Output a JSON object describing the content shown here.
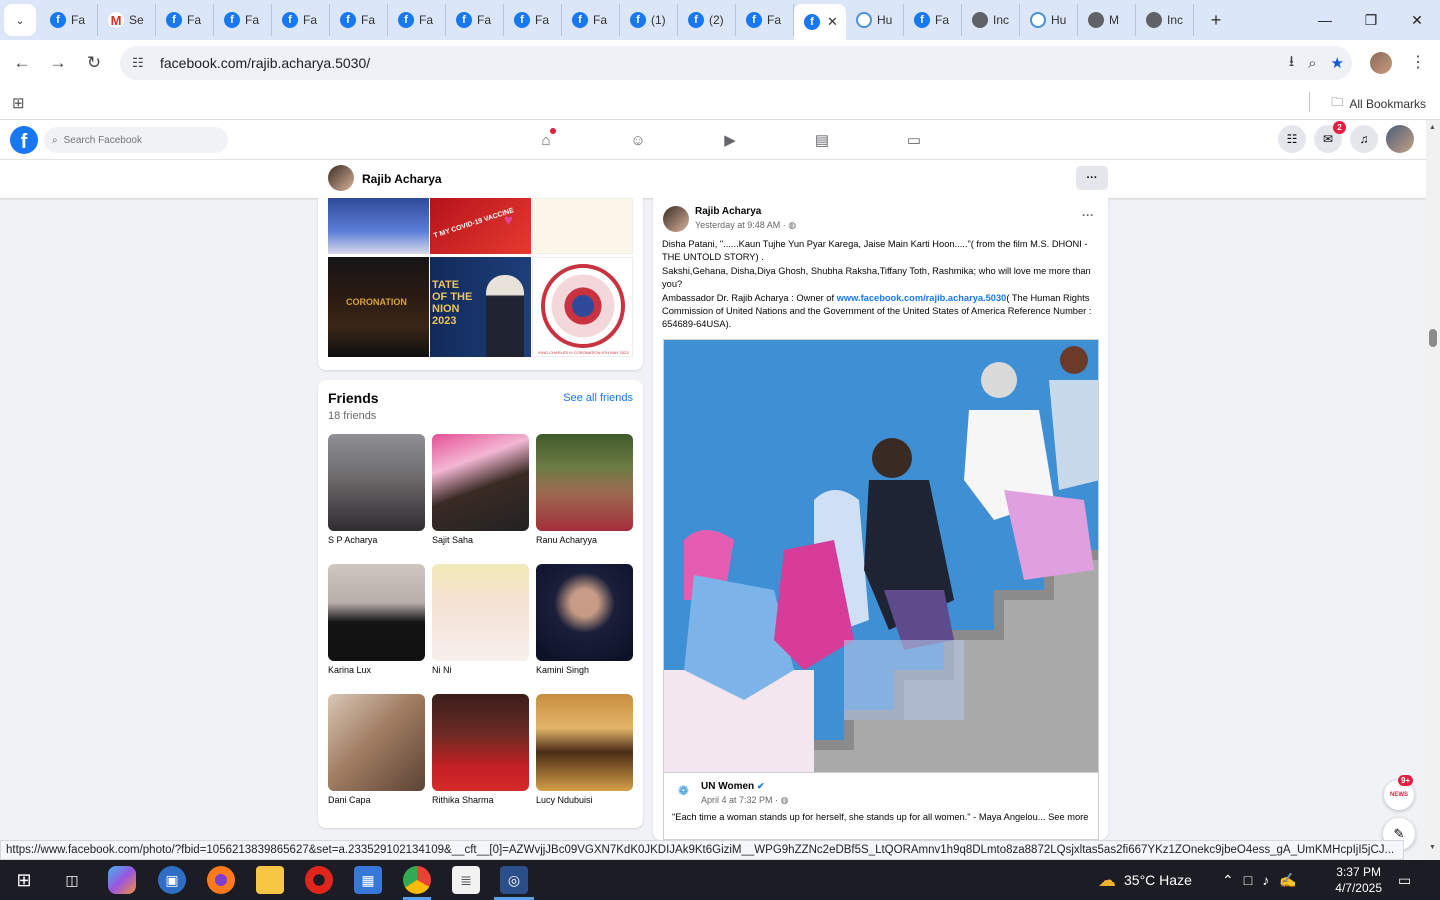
{
  "browser": {
    "tabs": [
      {
        "label": "Fa",
        "icon": "facebook"
      },
      {
        "label": "Se",
        "icon": "gmail"
      },
      {
        "label": "Fa",
        "icon": "facebook"
      },
      {
        "label": "Fa",
        "icon": "facebook"
      },
      {
        "label": "Fa",
        "icon": "facebook"
      },
      {
        "label": "Fa",
        "icon": "facebook"
      },
      {
        "label": "Fa",
        "icon": "facebook"
      },
      {
        "label": "Fa",
        "icon": "facebook"
      },
      {
        "label": "Fa",
        "icon": "facebook"
      },
      {
        "label": "Fa",
        "icon": "facebook"
      },
      {
        "label": "(1)",
        "icon": "facebook"
      },
      {
        "label": "(2)",
        "icon": "facebook"
      },
      {
        "label": "Fa",
        "icon": "facebook"
      },
      {
        "label": "",
        "icon": "facebook",
        "active": true
      },
      {
        "label": "Hu",
        "icon": "hive"
      },
      {
        "label": "Fa",
        "icon": "facebook"
      },
      {
        "label": "Inc",
        "icon": "globe"
      },
      {
        "label": "Hu",
        "icon": "hive"
      },
      {
        "label": "M",
        "icon": "globe"
      },
      {
        "label": "Inc",
        "icon": "globe"
      }
    ],
    "url": "facebook.com/rajib.acharya.5030/",
    "bookmarks_label": "All Bookmarks",
    "status_url": "https://www.facebook.com/photo/?fbid=1056213839865627&set=a.233529102134109&__cft__[0]=AZWvjjJBc09VGXN7KdK0JKDIJAk9Kt6GiziM__WPG9hZZNc2eDBf5S_LtQORAmnv1h9q8DLmto8za8872LQsjxltas5as2fi667YKz1ZOnekc9jbeO4ess_gA_UmKMHcpIjI5jCJ..."
  },
  "facebook": {
    "search_placeholder": "Search Facebook",
    "messenger_badge": "2",
    "profile_name": "Rajib Acharya",
    "more_label": "···"
  },
  "friends": {
    "title": "Friends",
    "count": "18 friends",
    "see_all": "See all friends",
    "items": [
      {
        "name": "S P Acharya"
      },
      {
        "name": "Sajit Saha"
      },
      {
        "name": "Ranu Acharyya"
      },
      {
        "name": "Karina Lux"
      },
      {
        "name": "Ni Ni"
      },
      {
        "name": "Kamini Singh"
      },
      {
        "name": "Dani Capa"
      },
      {
        "name": "Rithika Sharma"
      },
      {
        "name": "Lucy Ndubuisi"
      }
    ]
  },
  "photos": {
    "p1_caption": "T MY COVID-19 VACCINE",
    "p2_caption": "CORONATION",
    "p3_caption": "TATE OF THE NION 2023",
    "p4_caption": "KING CHARLES III CORONATION 6TH MAY 2023"
  },
  "post": {
    "author": "Rajib Acharya",
    "time": "Yesterday at 9:48 AM ·",
    "text_1": "Disha Patani, \"......Kaun Tujhe Yun Pyar Karega, Jaise Main Karti Hoon.....\"( from the film M.S. DHONI -THE UNTOLD STORY) .",
    "text_2": "Sakshi,Gehana, Disha,Diya Ghosh, Shubha Raksha,Tiffany Toth, Rashmika; who will love me more than you?",
    "text_3a": "Ambassador Dr. Rajib Acharya : Owner of ",
    "text_3_link": "www.facebook.com/rajib.acharya.5030",
    "text_3b": "( The Human Rights Commission of United Nations and the Government of the United  States of America Reference Number : 654689-64USA).",
    "shared_author": "UN Women",
    "shared_time": "April 4 at 7:32 PM ·",
    "shared_text": "\"Each time a woman stands up for herself, she stands up for all women.\" - Maya Angelou... See more"
  },
  "widgets": {
    "news_badge": "9+",
    "news_label": "NEWS"
  },
  "taskbar": {
    "weather": "35°C  Haze",
    "time": "3:37 PM",
    "date": "4/7/2025"
  },
  "colors": {
    "facebook_blue": "#1877f2",
    "tabstrip": "#dbe6f8",
    "taskbar": "#1c1c24"
  }
}
